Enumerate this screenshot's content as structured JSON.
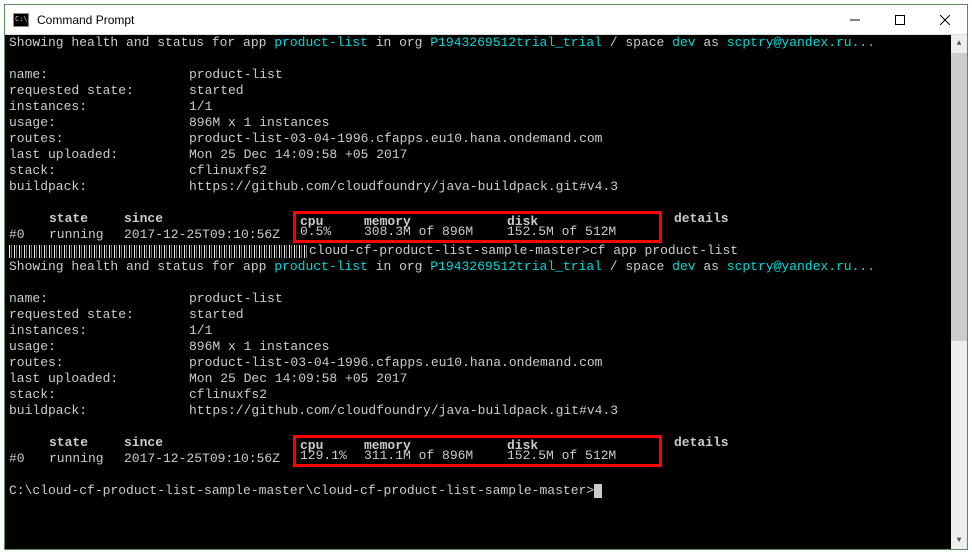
{
  "window": {
    "title": "Command Prompt"
  },
  "block1": {
    "intro": {
      "pre_app": "Showing health and status for app ",
      "app": "product-list",
      "mid1": " in org ",
      "org": "P1943269512trial_trial",
      "mid2": " / space ",
      "space": "dev",
      "mid3": " as ",
      "user": "scptry@yandex.ru",
      "tail": "..."
    },
    "kv": {
      "name_l": "name:",
      "name_v": "product-list",
      "requested_state_l": "requested state:",
      "requested_state_v": "started",
      "instances_l": "instances:",
      "instances_v": "1/1",
      "usage_l": "usage:",
      "usage_v": "896M x 1 instances",
      "routes_l": "routes:",
      "routes_v": "product-list-03-04-1996.cfapps.eu10.hana.ondemand.com",
      "last_uploaded_l": "last uploaded:",
      "last_uploaded_v": "Mon 25 Dec 14:09:58 +05 2017",
      "stack_l": "stack:",
      "stack_v": "cflinuxfs2",
      "buildpack_l": "buildpack:",
      "buildpack_v": "https://github.com/cloudfoundry/java-buildpack.git#v4.3"
    },
    "table": {
      "h_state": "state",
      "h_since": "since",
      "h_cpu": "cpu",
      "h_memory": "memory",
      "h_disk": "disk",
      "h_details": "details",
      "idx": "#0",
      "state": "running",
      "since": "2017-12-25T09:10:56Z",
      "cpu": "0.5%",
      "memory": "308.3M of 896M",
      "disk": "152.5M of 512M"
    }
  },
  "command_line": {
    "suffix": "cloud-cf-product-list-sample-master>",
    "cmd": "cf app product-list"
  },
  "block2": {
    "intro": {
      "pre_app": "Showing health and status for app ",
      "app": "product-list",
      "mid1": " in org ",
      "org": "P1943269512trial_trial",
      "mid2": " / space ",
      "space": "dev",
      "mid3": " as ",
      "user": "scptry@yandex.ru",
      "tail": "..."
    },
    "kv": {
      "name_l": "name:",
      "name_v": "product-list",
      "requested_state_l": "requested state:",
      "requested_state_v": "started",
      "instances_l": "instances:",
      "instances_v": "1/1",
      "usage_l": "usage:",
      "usage_v": "896M x 1 instances",
      "routes_l": "routes:",
      "routes_v": "product-list-03-04-1996.cfapps.eu10.hana.ondemand.com",
      "last_uploaded_l": "last uploaded:",
      "last_uploaded_v": "Mon 25 Dec 14:09:58 +05 2017",
      "stack_l": "stack:",
      "stack_v": "cflinuxfs2",
      "buildpack_l": "buildpack:",
      "buildpack_v": "https://github.com/cloudfoundry/java-buildpack.git#v4.3"
    },
    "table": {
      "h_state": "state",
      "h_since": "since",
      "h_cpu": "cpu",
      "h_memory": "memory",
      "h_disk": "disk",
      "h_details": "details",
      "idx": "#0",
      "state": "running",
      "since": "2017-12-25T09:10:56Z",
      "cpu": "129.1%",
      "memory": "311.1M of 896M",
      "disk": "152.5M of 512M"
    }
  },
  "prompt": {
    "text": "C:\\cloud-cf-product-list-sample-master\\cloud-cf-product-list-sample-master>"
  }
}
